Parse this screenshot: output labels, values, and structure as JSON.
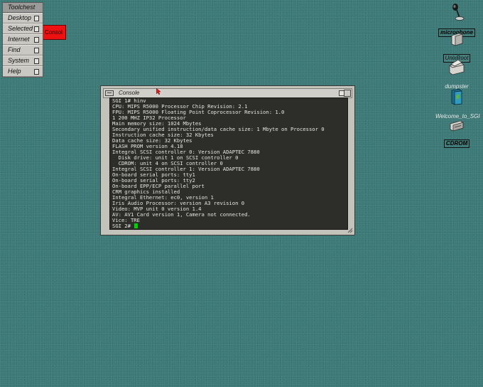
{
  "toolchest": {
    "title": "Toolchest",
    "items": [
      {
        "label": "Desktop"
      },
      {
        "label": "Selected"
      },
      {
        "label": "Internet"
      },
      {
        "label": "Find"
      },
      {
        "label": "System"
      },
      {
        "label": "Help"
      }
    ]
  },
  "background_window": {
    "label": "Consol"
  },
  "desktop_icons": [
    {
      "name": "microphone",
      "label": "microphone"
    },
    {
      "name": "unixroot",
      "label": "UnixRoot"
    },
    {
      "name": "dumpster",
      "label": "dumpster"
    },
    {
      "name": "welcome",
      "label": "Welcome_to_SGI"
    },
    {
      "name": "cdrom",
      "label": "CDROM"
    }
  ],
  "console": {
    "title": "Console",
    "lines": [
      "SGI 1# hinv",
      "CPU: MIPS R5000 Processor Chip Revision: 2.1",
      "FPU: MIPS R5000 Floating Point Coprocessor Revision: 1.0",
      "1 200 MHZ IP32 Processor",
      "Main memory size: 1024 Mbytes",
      "Secondary unified instruction/data cache size: 1 Mbyte on Processor 0",
      "Instruction cache size: 32 Kbytes",
      "Data cache size: 32 Kbytes",
      "FLASH PROM version 4.18",
      "Integral SCSI controller 0: Version ADAPTEC 7880",
      "  Disk drive: unit 1 on SCSI controller 0",
      "  CDROM: unit 4 on SCSI controller 0",
      "Integral SCSI controller 1: Version ADAPTEC 7880",
      "On-board serial ports: tty1",
      "On-board serial ports: tty2",
      "On-board EPP/ECP parallel port",
      "CRM graphics installed",
      "Integral Ethernet: ec0, version 1",
      "Iris Audio Processor: version A3 revision 0",
      "Video: MVP unit 0 version 1.4",
      "AV: AV1 Card version 1, Camera not connected.",
      "Vice: TRE"
    ],
    "prompt": "SGI 2# "
  },
  "colors": {
    "desktop": "#3d7a78",
    "terminal_bg": "#2d2e2a",
    "terminal_text": "#e6e6e2",
    "cursor": "#00d200",
    "background_window": "#ee1111"
  }
}
